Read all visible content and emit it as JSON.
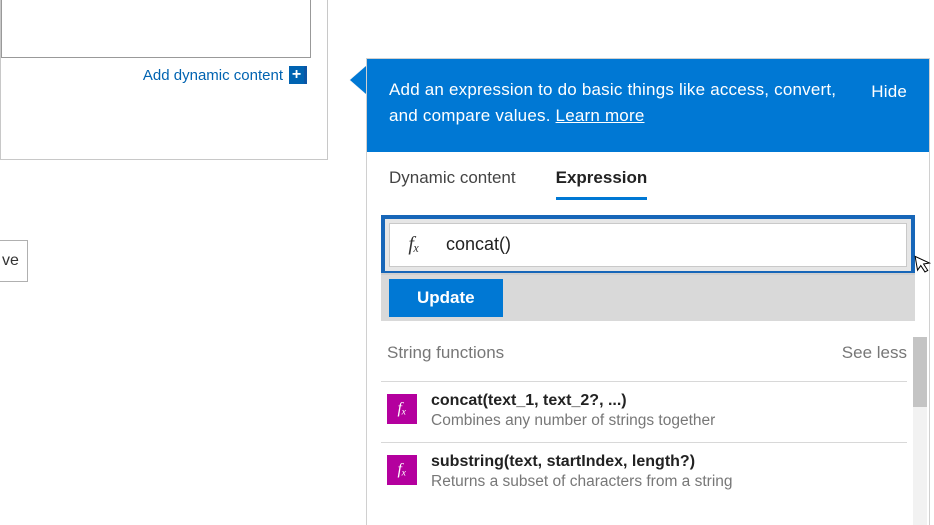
{
  "left": {
    "add_dynamic_label": "Add dynamic content",
    "save_fragment": "ve"
  },
  "panel": {
    "header_text": "Add an expression to do basic things like access, convert, and compare values. ",
    "learn_more": "Learn more",
    "hide": "Hide",
    "tabs": {
      "dynamic": "Dynamic content",
      "expression": "Expression"
    },
    "fx_label": "fₓ",
    "expression_value": "concat()",
    "update_btn": "Update",
    "section": {
      "title": "String functions",
      "toggle": "See less"
    },
    "functions": [
      {
        "signature": "concat(text_1, text_2?, ...)",
        "description": "Combines any number of strings together"
      },
      {
        "signature": "substring(text, startIndex, length?)",
        "description": "Returns a subset of characters from a string"
      }
    ]
  }
}
